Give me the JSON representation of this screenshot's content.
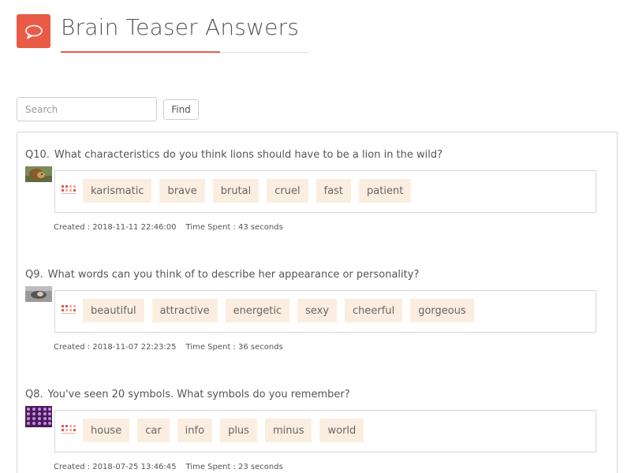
{
  "header": {
    "title": "Brain Teaser Answers",
    "icon": "speech-bubble-icon",
    "accent_color": "#ea5b47"
  },
  "search": {
    "placeholder": "Search",
    "value": "",
    "button_label": "Find"
  },
  "questions": [
    {
      "number": "Q10.",
      "text": "What characteristics do you think lions should have to be a lion in the wild?",
      "thumbnail": "lion-photo",
      "answers": [
        "karismatic",
        "brave",
        "brutal",
        "cruel",
        "fast",
        "patient"
      ],
      "created": "Created : 2018-11-11 22:46:00",
      "time_spent": "Time Spent : 43 seconds"
    },
    {
      "number": "Q9.",
      "text": "What words can you think of to describe her appearance or personality?",
      "thumbnail": "woman-photo",
      "answers": [
        "beautiful",
        "attractive",
        "energetic",
        "sexy",
        "cheerful",
        "gorgeous"
      ],
      "created": "Created : 2018-11-07 22:23:25",
      "time_spent": "Time Spent : 36 seconds"
    },
    {
      "number": "Q8.",
      "text": "You've seen 20 symbols. What symbols do you remember?",
      "thumbnail": "symbols-grid",
      "answers": [
        "house",
        "car",
        "info",
        "plus",
        "minus",
        "world"
      ],
      "created": "Created : 2018-07-25 13:46:45",
      "time_spent": "Time Spent : 23 seconds"
    }
  ],
  "colors": {
    "tag_background": "#fbeee0",
    "border": "#d6d6d6"
  }
}
